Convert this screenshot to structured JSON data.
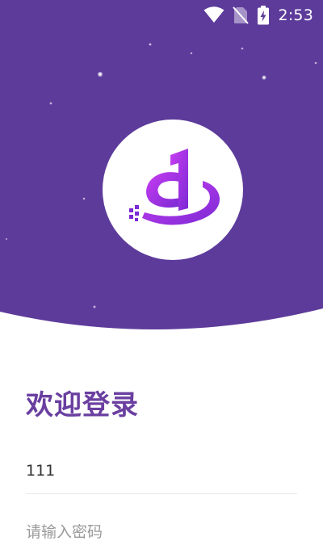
{
  "status_bar": {
    "time": "2:53",
    "icons": [
      "wifi-icon",
      "no-sim-icon",
      "battery-charging-icon"
    ]
  },
  "colors": {
    "header_purple": "#5d3b9b",
    "title_purple": "#6a3fa0",
    "logo_gradient_start": "#c13cf0",
    "logo_gradient_end": "#7d2bd6"
  },
  "login": {
    "title": "欢迎登录",
    "username_value": "111",
    "password_placeholder": "请输入密码"
  }
}
